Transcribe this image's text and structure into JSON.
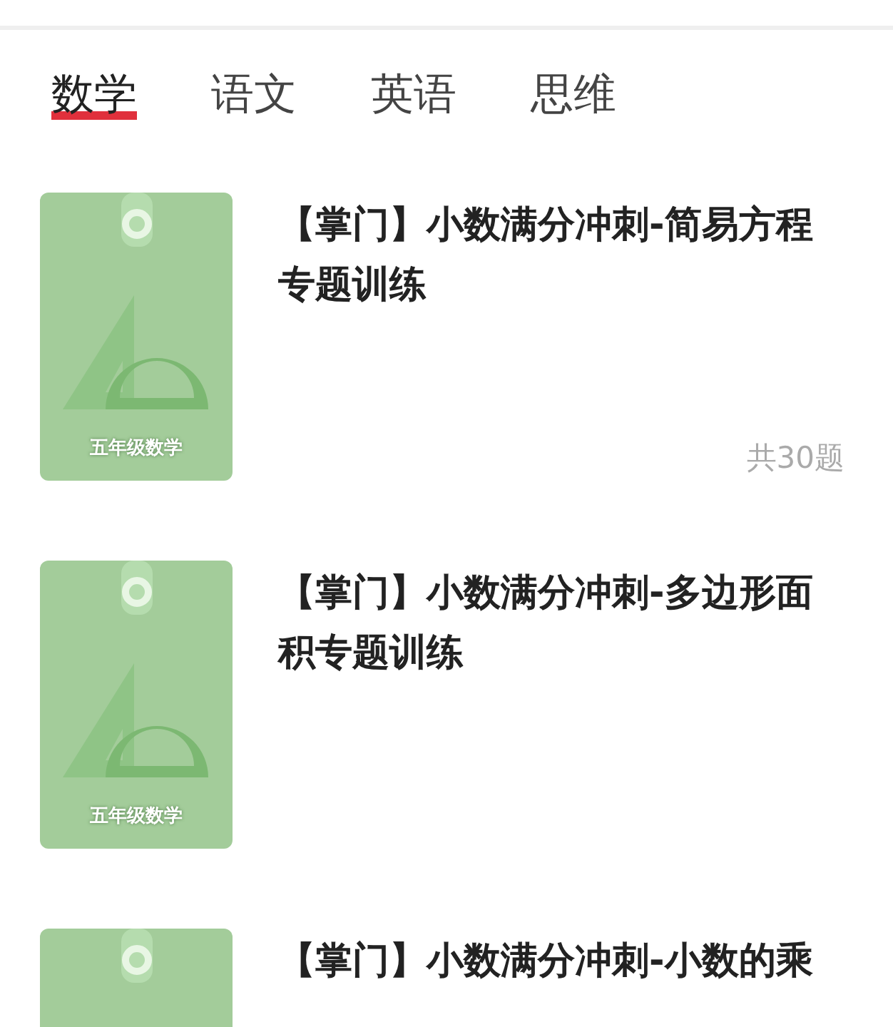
{
  "tabs": [
    {
      "label": "数学",
      "selected": true
    },
    {
      "label": "语文",
      "selected": false
    },
    {
      "label": "英语",
      "selected": false
    },
    {
      "label": "思维",
      "selected": false
    }
  ],
  "courses": [
    {
      "title": "【掌门】小数满分冲刺-简易方程专题训练",
      "cover_label": "五年级数学",
      "count": "共30题"
    },
    {
      "title": "【掌门】小数满分冲刺-多边形面积专题训练",
      "cover_label": "五年级数学"
    },
    {
      "title": "【掌门】小数满分冲刺-小数的乘"
    }
  ]
}
